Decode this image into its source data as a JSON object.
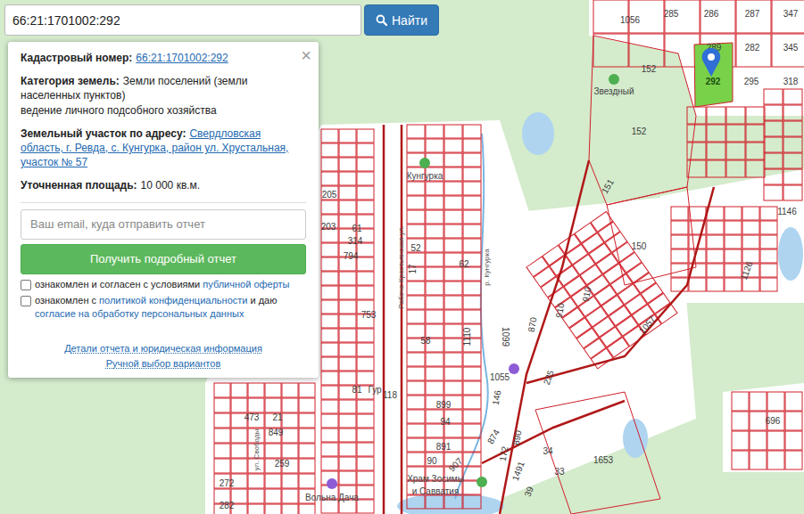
{
  "search": {
    "value": "66:21:1701002:292",
    "button": "Найти"
  },
  "popup": {
    "close": "×",
    "fields": [
      {
        "label": "Кадастровый номер:",
        "value": "66:21:1701002:292",
        "kind": "link"
      },
      {
        "label": "Категория земель:",
        "value": "Земли поселений (земли населенных пунктов)",
        "extra": "ведение личного подсобного хозяйства",
        "kind": "text"
      },
      {
        "label": "Земельный участок по адресу:",
        "value": "Свердловская область, г. Ревда, с. Кунгурка, район ул. Хрустальная, участок № 57",
        "kind": "link"
      },
      {
        "label": "Уточненная площадь:",
        "value": "10 000 кв.м.",
        "kind": "text"
      }
    ],
    "email_placeholder": "Ваш email, куда отправить отчет",
    "submit": "Получить подробный отчет",
    "agreements": [
      {
        "checked": false,
        "parts": [
          {
            "text": "ознакомлен и согласен с условиями ",
            "link": false
          },
          {
            "text": "публичной оферты",
            "link": true
          }
        ]
      },
      {
        "checked": false,
        "parts": [
          {
            "text": "ознакомлен с ",
            "link": false
          },
          {
            "text": "политикой конфиденциальности",
            "link": true
          },
          {
            "text": " и даю ",
            "link": false
          },
          {
            "text": "согласие на обработку персональных данных",
            "link": true
          }
        ]
      }
    ],
    "footer_links": [
      "Детали отчета и юридическая информация",
      "Ручной выбор вариантов"
    ]
  },
  "map": {
    "selected_parcel": "292",
    "labels": [
      {
        "text": "1056",
        "kind": "parcel"
      },
      {
        "text": "285",
        "kind": "parcel"
      },
      {
        "text": "286",
        "kind": "parcel"
      },
      {
        "text": "287",
        "kind": "parcel"
      },
      {
        "text": "347",
        "kind": "parcel"
      },
      {
        "text": "289",
        "kind": "parcel"
      },
      {
        "text": "282",
        "kind": "parcel"
      },
      {
        "text": "345",
        "kind": "parcel"
      },
      {
        "text": "152",
        "kind": "parcel"
      },
      {
        "text": "292",
        "kind": "parcel"
      },
      {
        "text": "295",
        "kind": "parcel"
      },
      {
        "text": "318",
        "kind": "parcel"
      },
      {
        "text": "152",
        "kind": "parcel"
      },
      {
        "text": "151",
        "kind": "parcel"
      },
      {
        "text": "1146",
        "kind": "parcel"
      },
      {
        "text": "150",
        "kind": "parcel"
      },
      {
        "text": "1126",
        "kind": "parcel"
      },
      {
        "text": "205",
        "kind": "parcel"
      },
      {
        "text": "203",
        "kind": "parcel"
      },
      {
        "text": "61",
        "kind": "parcel"
      },
      {
        "text": "314",
        "kind": "parcel"
      },
      {
        "text": "794",
        "kind": "parcel"
      },
      {
        "text": "52",
        "kind": "parcel"
      },
      {
        "text": "62",
        "kind": "parcel"
      },
      {
        "text": "17",
        "kind": "parcel"
      },
      {
        "text": "753",
        "kind": "parcel"
      },
      {
        "text": "58",
        "kind": "parcel"
      },
      {
        "text": "1110",
        "kind": "parcel"
      },
      {
        "text": "1099",
        "kind": "parcel"
      },
      {
        "text": "870",
        "kind": "parcel"
      },
      {
        "text": "910",
        "kind": "parcel"
      },
      {
        "text": "910",
        "kind": "parcel"
      },
      {
        "text": "1057",
        "kind": "parcel"
      },
      {
        "text": "1055",
        "kind": "parcel"
      },
      {
        "text": "146",
        "kind": "parcel"
      },
      {
        "text": "225",
        "kind": "parcel"
      },
      {
        "text": "899",
        "kind": "parcel"
      },
      {
        "text": "94",
        "kind": "parcel"
      },
      {
        "text": "81",
        "kind": "parcel"
      },
      {
        "text": "118",
        "kind": "parcel"
      },
      {
        "text": "473",
        "kind": "parcel"
      },
      {
        "text": "21",
        "kind": "parcel"
      },
      {
        "text": "849",
        "kind": "parcel"
      },
      {
        "text": "891",
        "kind": "parcel"
      },
      {
        "text": "90",
        "kind": "parcel"
      },
      {
        "text": "907",
        "kind": "parcel"
      },
      {
        "text": "259",
        "kind": "parcel"
      },
      {
        "text": "874",
        "kind": "parcel"
      },
      {
        "text": "172",
        "kind": "parcel"
      },
      {
        "text": "890",
        "kind": "parcel"
      },
      {
        "text": "34",
        "kind": "parcel"
      },
      {
        "text": "33",
        "kind": "parcel"
      },
      {
        "text": "39",
        "kind": "parcel"
      },
      {
        "text": "1491",
        "kind": "parcel"
      },
      {
        "text": "1653",
        "kind": "parcel"
      },
      {
        "text": "272",
        "kind": "parcel"
      },
      {
        "text": "282",
        "kind": "parcel"
      },
      {
        "text": "696",
        "kind": "parcel"
      },
      {
        "text": "Звездный",
        "kind": "place"
      },
      {
        "text": "Кунгурка",
        "kind": "place"
      },
      {
        "text": "Рабоче-Крестьянская ул.",
        "kind": "street"
      },
      {
        "text": "р. Кунгурка",
        "kind": "street"
      },
      {
        "text": "Гур",
        "kind": "place"
      },
      {
        "text": "ул. Свободы",
        "kind": "street"
      },
      {
        "text": "Храм Зосимы",
        "kind": "place"
      },
      {
        "text": "и Савватия",
        "kind": "place"
      },
      {
        "text": "Вольна Дача",
        "kind": "place"
      }
    ]
  }
}
